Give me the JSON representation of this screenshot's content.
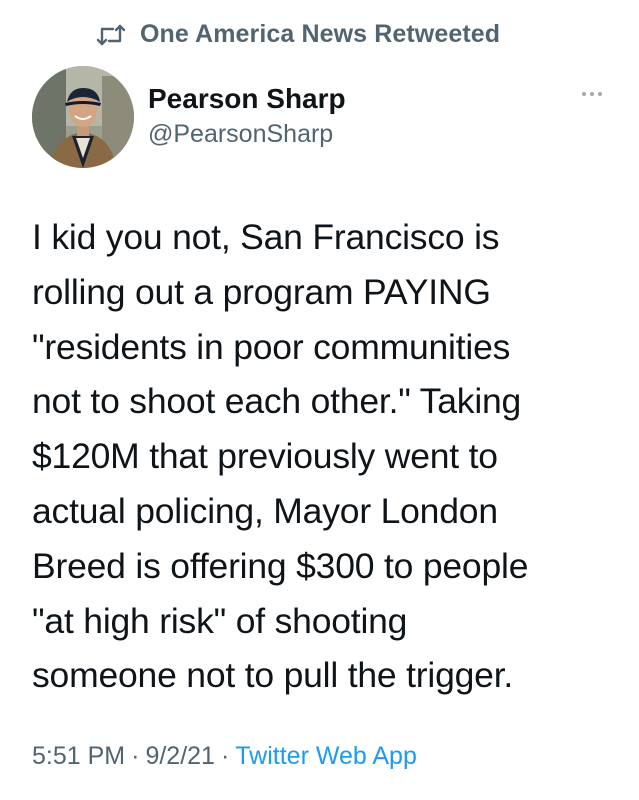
{
  "retweet": {
    "label": "One America News Retweeted",
    "icon": "retweet-icon"
  },
  "author": {
    "name": "Pearson Sharp",
    "handle": "@PearsonSharp",
    "avatar": "avatar-photo"
  },
  "more_icon": "more-horizontal-icon",
  "tweet": {
    "text": "I kid you not, San Francisco is\nrolling out a program PAYING\n\"residents in poor communities\nnot to shoot each other.\" Taking\n$120M that previously went to\nactual policing, Mayor London\nBreed is offering $300 to people\n\"at high risk\" of shooting\nsomeone not to pull the trigger."
  },
  "meta": {
    "time": "5:51 PM",
    "separator": "·",
    "date": "9/2/21",
    "source": "Twitter Web App"
  },
  "colors": {
    "text_primary": "#0f1419",
    "text_secondary": "#536471",
    "link": "#1d9bf0",
    "background": "#ffffff"
  }
}
